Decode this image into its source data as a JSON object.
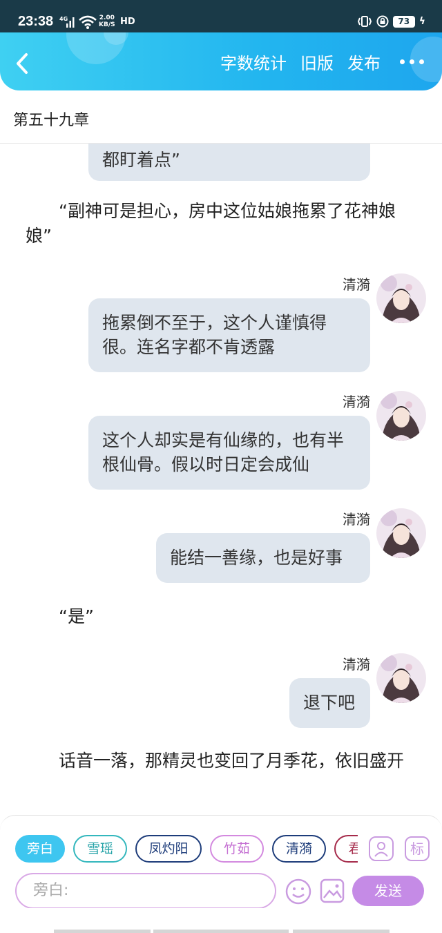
{
  "status_bar": {
    "time": "23:38",
    "network": "4G",
    "speed_value": "2.00",
    "speed_unit": "KB/S",
    "hd": "HD",
    "battery": "73"
  },
  "app_bar": {
    "actions": [
      "字数统计",
      "旧版",
      "发布"
    ],
    "colors": {
      "gradient_start": "#3fd0f2",
      "gradient_end": "#1ea6ee"
    }
  },
  "chapter": {
    "title": "第五十九章"
  },
  "messages": [
    {
      "type": "bubble",
      "text": "都盯着点”"
    },
    {
      "type": "narration",
      "text": "“副神可是担心，房中这位姑娘拖累了花神娘娘”"
    },
    {
      "type": "bubble",
      "speaker": "清漪",
      "text": "拖累倒不至于，这个人谨慎得很。连名字都不肯透露"
    },
    {
      "type": "bubble",
      "speaker": "清漪",
      "text": "这个人却实是有仙缘的，也有半根仙骨。假以时日定会成仙"
    },
    {
      "type": "bubble",
      "speaker": "清漪",
      "text": "能结一善缘，也是好事"
    },
    {
      "type": "narration",
      "text": "“是”"
    },
    {
      "type": "bubble",
      "speaker": "清漪",
      "text": "退下吧"
    },
    {
      "type": "narration",
      "text": "话音一落，那精灵也变回了月季花，依旧盛开"
    }
  ],
  "composer": {
    "roles": [
      "旁白",
      "雪瑶",
      "凤灼阳",
      "竹茹",
      "清漪",
      "君"
    ],
    "active_role": "旁白",
    "role_icon": "person-icon",
    "tag_label": "标",
    "input_placeholder": "旁白:",
    "send_label": "发送",
    "accent_color": "#c58be6"
  }
}
